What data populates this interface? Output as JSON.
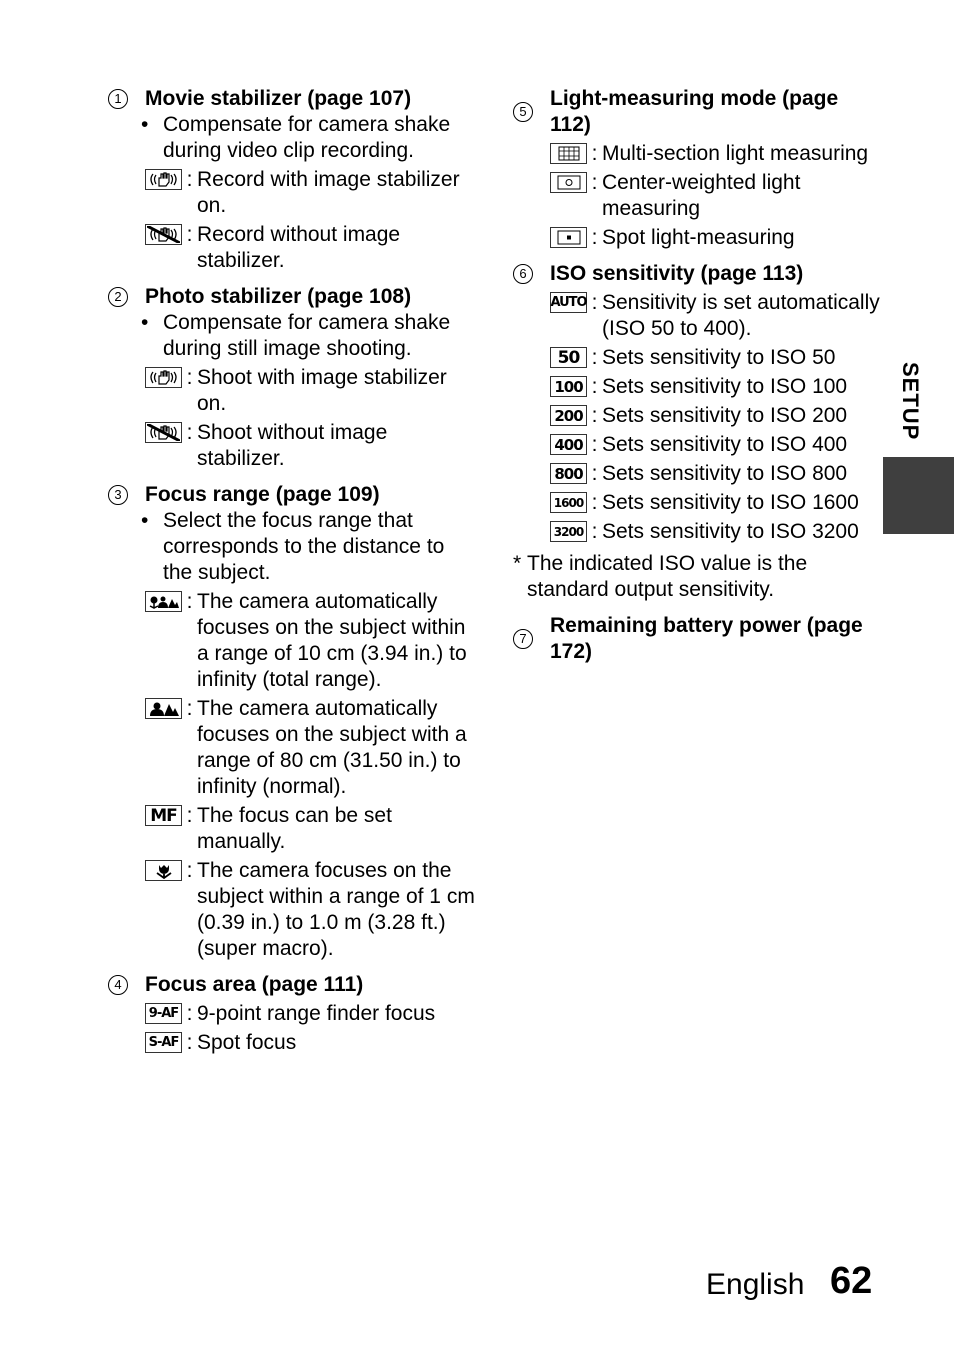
{
  "side_tab": {
    "label": "SETUP",
    "color": "#3f3f3f"
  },
  "footer": {
    "language": "English",
    "page_number": "62"
  },
  "sections": [
    {
      "num": "1",
      "title": "Movie stabilizer (page 107)",
      "bullet": "Compensate for camera shake during video clip recording.",
      "items": [
        {
          "icon": "stabilizer-on-icon",
          "text": "Record with image stabilizer on."
        },
        {
          "icon": "stabilizer-off-icon",
          "text": "Record without image stabilizer."
        }
      ]
    },
    {
      "num": "2",
      "title": "Photo stabilizer (page 108)",
      "bullet": "Compensate for camera shake during still image shooting.",
      "items": [
        {
          "icon": "stabilizer-on-icon",
          "text": "Shoot with image stabilizer on."
        },
        {
          "icon": "stabilizer-off-icon",
          "text": "Shoot without image stabilizer."
        }
      ]
    },
    {
      "num": "3",
      "title": "Focus range (page 109)",
      "bullet": "Select the focus range that corresponds to the distance to the subject.",
      "items": [
        {
          "icon": "total-range-focus-icon",
          "text": "The camera automatically focuses on the subject within a range of 10 cm (3.94 in.) to infinity (total range)."
        },
        {
          "icon": "normal-focus-icon",
          "text": "The camera automatically focuses on the subject with a range of 80 cm (31.50 in.) to infinity (normal)."
        },
        {
          "icon": "manual-focus-icon",
          "label": "MF",
          "text": "The focus can be set manually."
        },
        {
          "icon": "super-macro-icon",
          "text": "The camera focuses on the subject within a range of 1 cm (0.39 in.) to 1.0 m (3.28 ft.) (super macro)."
        }
      ]
    },
    {
      "num": "4",
      "title": "Focus area (page 111)",
      "items": [
        {
          "icon": "nine-point-af-icon",
          "label": "9-AF",
          "text": "9-point range finder focus"
        },
        {
          "icon": "spot-af-icon",
          "label": "S-AF",
          "text": "Spot focus"
        }
      ]
    },
    {
      "num": "5",
      "title": "Light-measuring mode (page 112)",
      "items": [
        {
          "icon": "multi-section-metering-icon",
          "text": "Multi-section light measuring"
        },
        {
          "icon": "center-weighted-metering-icon",
          "text": "Center-weighted light measuring"
        },
        {
          "icon": "spot-metering-icon",
          "text": "Spot light-measuring"
        }
      ]
    },
    {
      "num": "6",
      "title": "ISO sensitivity (page 113)",
      "items": [
        {
          "icon": "iso-auto-icon",
          "label": "AUTO",
          "text": "Sensitivity is set automatically (ISO 50 to 400)."
        },
        {
          "icon": "iso-50-icon",
          "label": "50",
          "text": "Sets sensitivity to ISO 50"
        },
        {
          "icon": "iso-100-icon",
          "label": "100",
          "text": "Sets sensitivity to ISO 100"
        },
        {
          "icon": "iso-200-icon",
          "label": "200",
          "text": "Sets sensitivity to ISO 200"
        },
        {
          "icon": "iso-400-icon",
          "label": "400",
          "text": "Sets sensitivity to ISO 400"
        },
        {
          "icon": "iso-800-icon",
          "label": "800",
          "text": "Sets sensitivity to ISO 800"
        },
        {
          "icon": "iso-1600-icon",
          "label": "1600",
          "text": "Sets sensitivity to ISO 1600"
        },
        {
          "icon": "iso-3200-icon",
          "label": "3200",
          "text": "Sets sensitivity to ISO 3200"
        }
      ],
      "note": "The indicated ISO value is the standard output sensitivity."
    },
    {
      "num": "7",
      "title": "Remaining battery power (page 172)"
    }
  ]
}
